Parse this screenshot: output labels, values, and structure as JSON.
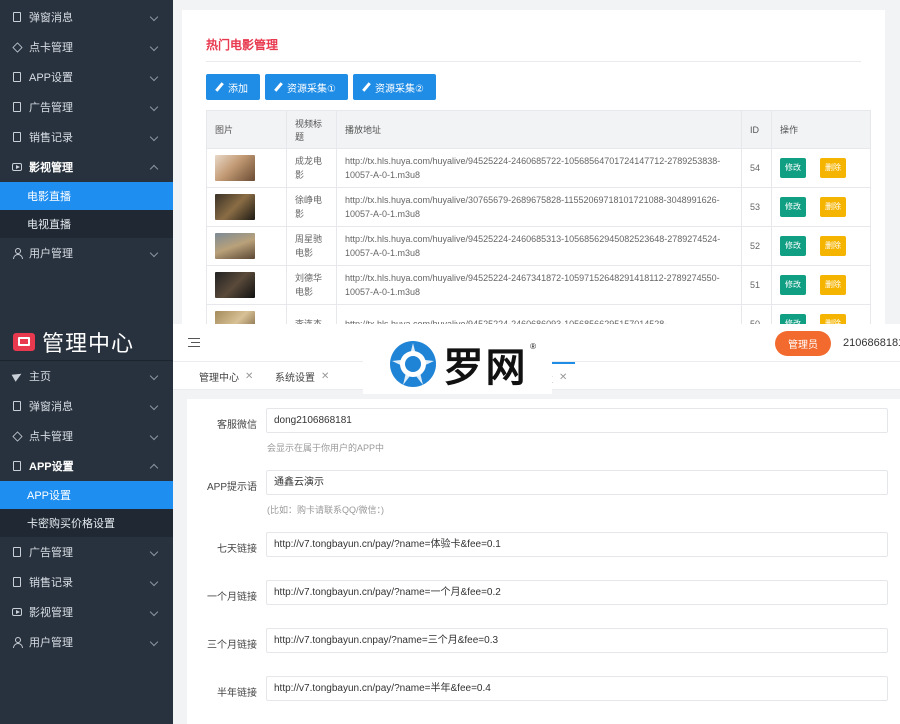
{
  "top_sidebar": {
    "items": [
      {
        "label": "弹窗消息",
        "icon": "doc-icon"
      },
      {
        "label": "点卡管理",
        "icon": "cube-icon"
      },
      {
        "label": "APP设置",
        "icon": "doc-icon"
      },
      {
        "label": "广告管理",
        "icon": "doc-icon"
      },
      {
        "label": "销售记录",
        "icon": "doc-icon"
      },
      {
        "label": "影视管理",
        "icon": "play-icon"
      }
    ],
    "subitems": [
      {
        "label": "电影直播"
      },
      {
        "label": "电视直播"
      }
    ],
    "last_item": {
      "label": "用户管理",
      "icon": "user-icon"
    }
  },
  "movies": {
    "title": "热门电影管理",
    "buttons": {
      "add": "添加",
      "collect1": "资源采集①",
      "collect2": "资源采集②"
    },
    "columns": [
      "图片",
      "视频标题",
      "播放地址",
      "ID",
      "操作"
    ],
    "edit_label": "修改",
    "delete_label": "删除",
    "rows": [
      {
        "title": "成龙电影",
        "url": "http://tx.hls.huya.com/huyalive/94525224-2460685722-10568564701724147712-2789253838-10057-A-0-1.m3u8",
        "id": "54"
      },
      {
        "title": "徐峥电影",
        "url": "http://tx.hls.huya.com/huyalive/30765679-2689675828-11552069718101721088-3048991626-10057-A-0-1.m3u8",
        "id": "53"
      },
      {
        "title": "周星驰电影",
        "url": "http://tx.hls.huya.com/huyalive/94525224-2460685313-10568562945082523648-2789274524-10057-A-0-1.m3u8",
        "id": "52"
      },
      {
        "title": "刘德华电影",
        "url": "http://tx.hls.huya.com/huyalive/94525224-2467341872-10597152648291418112-2789274550-10057-A-0-1.m3u8",
        "id": "51"
      },
      {
        "title": "李连杰",
        "url": "http://tx.hls.huya.com/huyalive/94525224-2460686093-10568566295157014528-",
        "id": "50"
      }
    ]
  },
  "bottom_sidebar": {
    "brand": "管理中心",
    "items_before": [
      {
        "label": "主页",
        "icon": "send-icon"
      },
      {
        "label": "弹窗消息",
        "icon": "doc-icon"
      },
      {
        "label": "点卡管理",
        "icon": "cube-icon"
      },
      {
        "label": "APP设置",
        "icon": "doc-icon"
      }
    ],
    "subitems": [
      {
        "label": "APP设置"
      },
      {
        "label": "卡密购买价格设置"
      }
    ],
    "items_after": [
      {
        "label": "广告管理",
        "icon": "doc-icon"
      },
      {
        "label": "销售记录",
        "icon": "doc-icon"
      },
      {
        "label": "影视管理",
        "icon": "play-icon"
      },
      {
        "label": "用户管理",
        "icon": "user-icon"
      }
    ]
  },
  "header": {
    "admin_label": "管理员",
    "account": "2106868181"
  },
  "tabs": [
    {
      "label": "管理中心"
    },
    {
      "label": "系统设置"
    },
    {
      "label": "置"
    }
  ],
  "watermark": {
    "text": "罗网",
    "reg": "®"
  },
  "settings": {
    "fields": [
      {
        "label": "客服微信",
        "value": "dong2106868181",
        "hint": "会显示在属于你用户的APP中"
      },
      {
        "label": "APP提示语",
        "value": "通鑫云演示",
        "hint": "(比如：购卡请联系QQ/微信：)"
      },
      {
        "label": "七天链接",
        "value": "http://v7.tongbayun.cn/pay/?name=体验卡&fee=0.1"
      },
      {
        "label": "一个月链接",
        "value": "http://v7.tongbayun.cn/pay/?name=一个月&fee=0.2"
      },
      {
        "label": "三个月链接",
        "value": "http://v7.tongbayun.cnpay/?name=三个月&fee=0.3"
      },
      {
        "label": "半年链接",
        "value": "http://v7.tongbayun.cn/pay/?name=半年&fee=0.4"
      }
    ]
  },
  "colors": {
    "sidebar_bg": "#28323e",
    "accent_blue": "#1e8ff0",
    "title_red": "#e8394f",
    "admin_orange": "#f26a2d",
    "edit_green": "#119f83",
    "delete_yellow": "#f5b400"
  }
}
